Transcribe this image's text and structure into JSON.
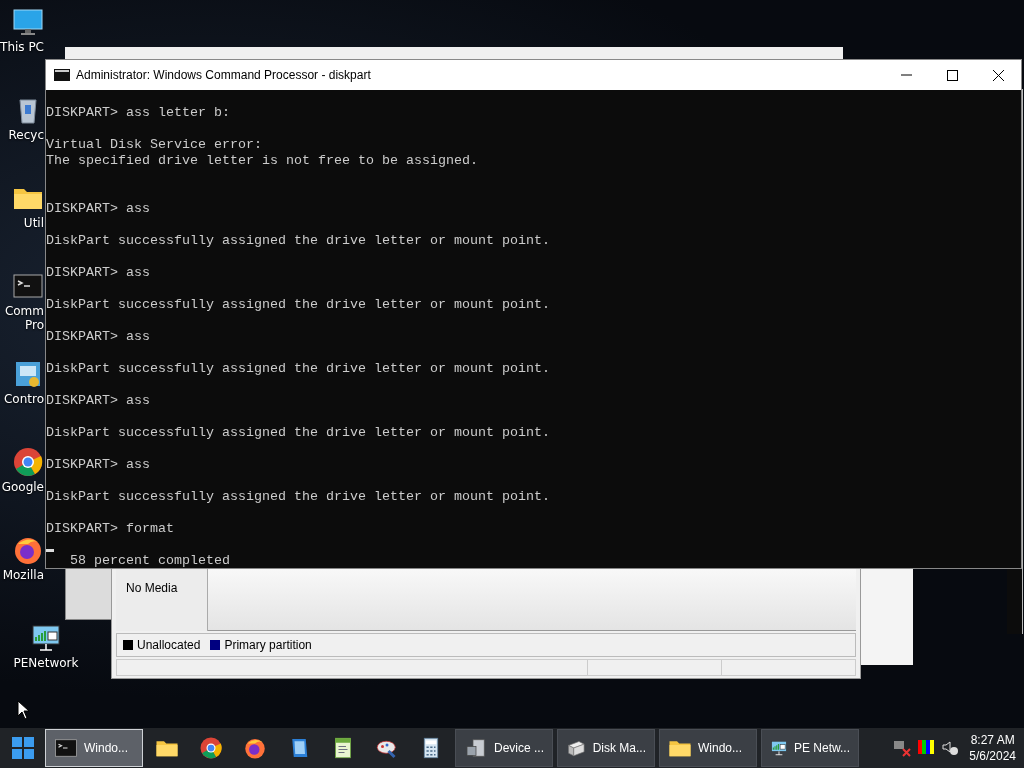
{
  "desktop_icons": [
    {
      "label": "This PC",
      "kind": "pc"
    },
    {
      "label": "Recyc",
      "kind": "recycle"
    },
    {
      "label": "Util",
      "kind": "folder"
    },
    {
      "label": "Comm\nPro",
      "kind": "console"
    },
    {
      "label": "Contro",
      "kind": "control"
    },
    {
      "label": "Google",
      "kind": "chrome"
    },
    {
      "label": "Mozilla",
      "kind": "firefox"
    },
    {
      "label": "PENetwork",
      "kind": "network"
    }
  ],
  "console_window": {
    "title": "Administrator: Windows Command Processor - diskpart",
    "lines": [
      {
        "kind": "text",
        "text": "DISKPART> ass letter b:"
      },
      {
        "kind": "blank"
      },
      {
        "kind": "text",
        "text": "Virtual Disk Service error:"
      },
      {
        "kind": "text",
        "text": "The specified drive letter is not free to be assigned."
      },
      {
        "kind": "blank"
      },
      {
        "kind": "blank"
      },
      {
        "kind": "text",
        "text": "DISKPART> ass"
      },
      {
        "kind": "blank"
      },
      {
        "kind": "text",
        "text": "DiskPart successfully assigned the drive letter or mount point."
      },
      {
        "kind": "blank"
      },
      {
        "kind": "text",
        "text": "DISKPART> ass"
      },
      {
        "kind": "blank"
      },
      {
        "kind": "text",
        "text": "DiskPart successfully assigned the drive letter or mount point."
      },
      {
        "kind": "blank"
      },
      {
        "kind": "text",
        "text": "DISKPART> ass"
      },
      {
        "kind": "blank"
      },
      {
        "kind": "text",
        "text": "DiskPart successfully assigned the drive letter or mount point."
      },
      {
        "kind": "blank"
      },
      {
        "kind": "text",
        "text": "DISKPART> ass"
      },
      {
        "kind": "blank"
      },
      {
        "kind": "text",
        "text": "DiskPart successfully assigned the drive letter or mount point."
      },
      {
        "kind": "blank"
      },
      {
        "kind": "text",
        "text": "DISKPART> ass"
      },
      {
        "kind": "blank"
      },
      {
        "kind": "text",
        "text": "DiskPart successfully assigned the drive letter or mount point."
      },
      {
        "kind": "blank"
      },
      {
        "kind": "text",
        "text": "DISKPART> format"
      },
      {
        "kind": "blank"
      },
      {
        "kind": "text",
        "text": "   58 percent completed"
      }
    ]
  },
  "disk_management": {
    "disk_status": "No Media",
    "legend": [
      {
        "label": "Unallocated",
        "color": "#000000"
      },
      {
        "label": "Primary partition",
        "color": "#000080"
      }
    ]
  },
  "taskbar": {
    "items": [
      {
        "kind": "console",
        "label": "Windo...",
        "selected": true
      },
      {
        "kind": "folder"
      },
      {
        "kind": "chrome"
      },
      {
        "kind": "firefox"
      },
      {
        "kind": "notebook"
      },
      {
        "kind": "document"
      },
      {
        "kind": "palette"
      },
      {
        "kind": "calculator"
      },
      {
        "kind": "device",
        "label": "Device ...",
        "selected": false
      },
      {
        "kind": "disk",
        "label": "Disk Ma...",
        "selected": false
      },
      {
        "kind": "folder",
        "label": "Windo...",
        "selected": false
      },
      {
        "kind": "network",
        "label": "PE Netw...",
        "selected": false
      }
    ],
    "time": "8:27 AM",
    "date": "5/6/2024"
  }
}
